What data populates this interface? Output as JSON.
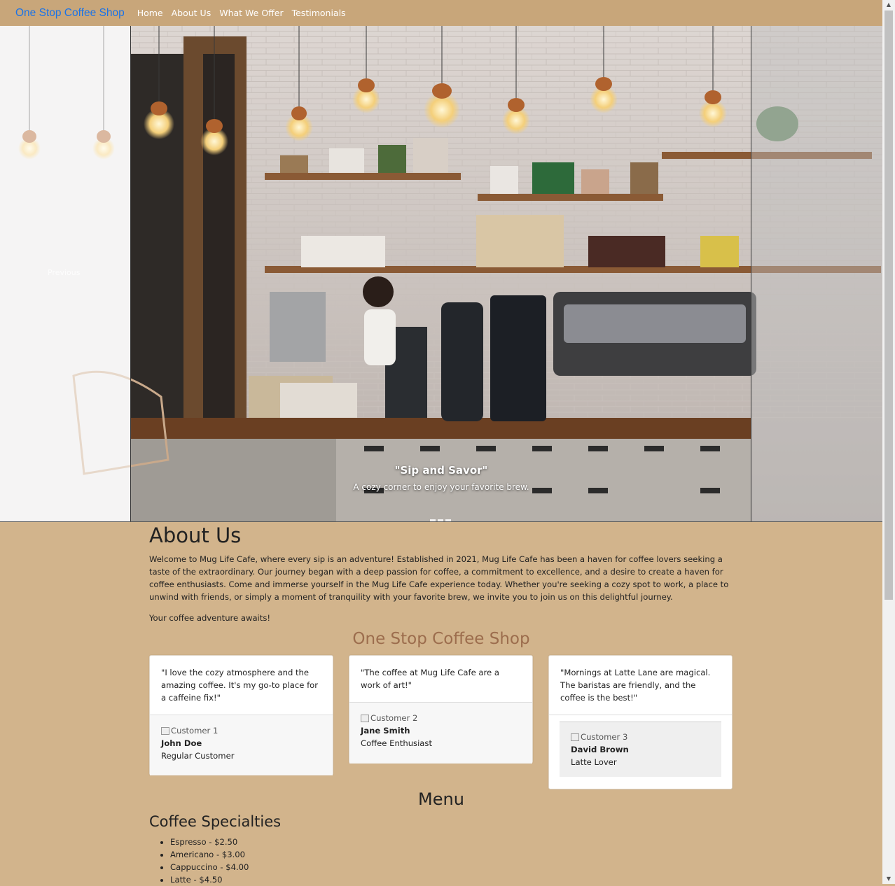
{
  "nav": {
    "brand": "One Stop Coffee Shop",
    "links": [
      "Home",
      "About Us",
      "What We Offer",
      "Testimonials"
    ]
  },
  "carousel": {
    "prev_label": "Previous",
    "caption_title": "\"Sip and Savor\"",
    "caption_text": "A cozy corner to enjoy your favorite brew.",
    "slides": 3,
    "active_slide": 1
  },
  "about": {
    "title": "About Us",
    "paragraph1": "Welcome to Mug Life Cafe, where every sip is an adventure! Established in 2021, Mug Life Cafe has been a haven for coffee lovers seeking a taste of the extraordinary. Our journey began with a deep passion for coffee, a commitment to excellence, and a desire to create a haven for coffee enthusiasts. Come and immerse yourself in the Mug Life Cafe experience today. Whether you're seeking a cozy spot to work, a place to unwind with friends, or simply a moment of tranquility with your favorite brew, we invite you to join us on this delightful journey.",
    "paragraph2": "Your coffee adventure awaits!"
  },
  "testimonials": {
    "heading": "One Stop Coffee Shop",
    "cards": [
      {
        "quote": "\"I love the cozy atmosphere and the amazing coffee. It's my go-to place for a caffeine fix!\"",
        "img_alt": "Customer 1",
        "name": "John Doe",
        "role": "Regular Customer"
      },
      {
        "quote": "\"The coffee at Mug Life Cafe are a work of art!\"",
        "img_alt": "Customer 2",
        "name": "Jane Smith",
        "role": "Coffee Enthusiast"
      },
      {
        "quote": "\"Mornings at Latte Lane are magical. The baristas are friendly, and the coffee is the best!\"",
        "img_alt": "Customer 3",
        "name": "David Brown",
        "role": "Latte Lover"
      }
    ]
  },
  "menu": {
    "heading": "Menu",
    "section": "Coffee Specialties",
    "items": [
      "Espresso - $2.50",
      "Americano - $3.00",
      "Cappuccino - $4.00",
      "Latte - $4.50"
    ]
  },
  "colors": {
    "page_bg": "#D2B48C",
    "nav_bg": "#C8A67A",
    "brand": "#1a73e8",
    "accent_heading": "#9c6d4d"
  }
}
